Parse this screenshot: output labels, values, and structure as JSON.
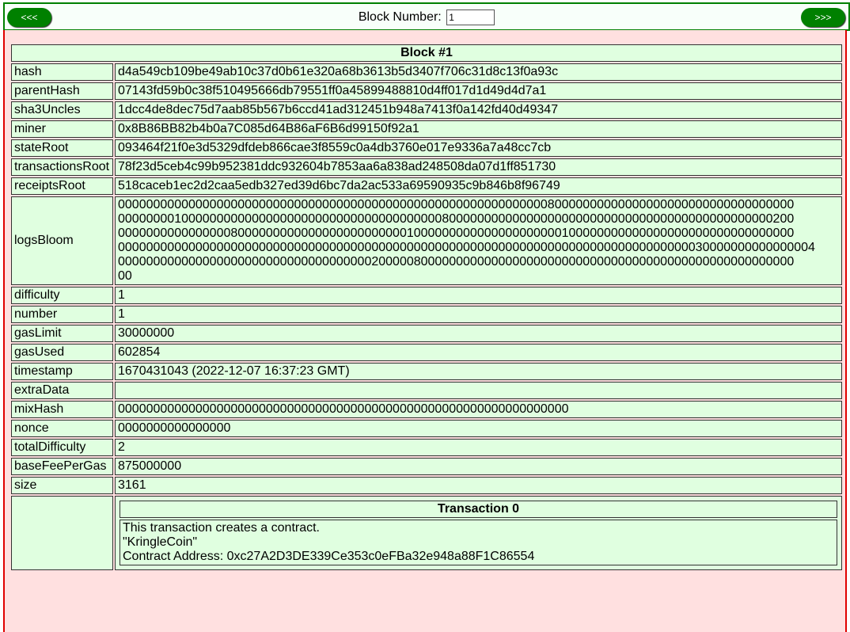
{
  "nav": {
    "prev_label": "<<<",
    "next_label": ">>>",
    "block_number_label": "Block Number:",
    "block_number_value": "1"
  },
  "block": {
    "title": "Block #1",
    "fields": [
      {
        "key": "hash",
        "value": "d4a549cb109be49ab10c37d0b61e320a68b3613b5d3407f706c31d8c13f0a93c"
      },
      {
        "key": "parentHash",
        "value": "07143fd59b0c38f510495666db79551ff0a45899488810d4ff017d1d49d4d7a1"
      },
      {
        "key": "sha3Uncles",
        "value": "1dcc4de8dec75d7aab85b567b6ccd41ad312451b948a7413f0a142fd40d49347"
      },
      {
        "key": "miner",
        "value": "0x8B86BB82b4b0a7C085d64B86aF6B6d99150f92a1"
      },
      {
        "key": "stateRoot",
        "value": "093464f21f0e3d5329dfdeb866cae3f8559c0a4db3760e017e9336a7a48cc7cb"
      },
      {
        "key": "transactionsRoot",
        "value": "78f23d5ceb4c99b952381ddc932604b7853aa6a838ad248508da07d1ff851730"
      },
      {
        "key": "receiptsRoot",
        "value": "518caceb1ec2d2caa5edb327ed39d6bc7da2ac533a69590935c9b846b8f96749"
      }
    ],
    "logs_bloom": {
      "key": "logsBloom",
      "lines": [
        "000000000000000000000000000000000000000000000000000000000000080000000000000000000000000000000000",
        "000000001000000000000000000000000000000000000080000000000000000000000000000000000000000000000200",
        "000000000000000080000000000000000000000001000000000000000000000100000000000000000000000000000000",
        "000000000000000000000000000000000000000000000000000000000000000000000000000000000030000000000000004",
        "000000000000000000000000000000000000200000800000000000000000000000000000000000000000000000000000",
        "00"
      ]
    },
    "fields2": [
      {
        "key": "difficulty",
        "value": "1"
      },
      {
        "key": "number",
        "value": "1"
      },
      {
        "key": "gasLimit",
        "value": "30000000"
      },
      {
        "key": "gasUsed",
        "value": "602854"
      },
      {
        "key": "timestamp",
        "value": "1670431043 (2022-12-07 16:37:23 GMT)"
      },
      {
        "key": "extraData",
        "value": ""
      },
      {
        "key": "mixHash",
        "value": "0000000000000000000000000000000000000000000000000000000000000000"
      },
      {
        "key": "nonce",
        "value": "0000000000000000"
      },
      {
        "key": "totalDifficulty",
        "value": "2"
      },
      {
        "key": "baseFeePerGas",
        "value": "875000000"
      },
      {
        "key": "size",
        "value": "3161"
      }
    ],
    "transaction": {
      "title": "Transaction 0",
      "line1": "This transaction creates a contract.",
      "line2": "\"KringleCoin\"",
      "line3": "Contract Address: 0xc27A2D3DE339Ce353c0eFBa32e948a88F1C86554"
    }
  }
}
